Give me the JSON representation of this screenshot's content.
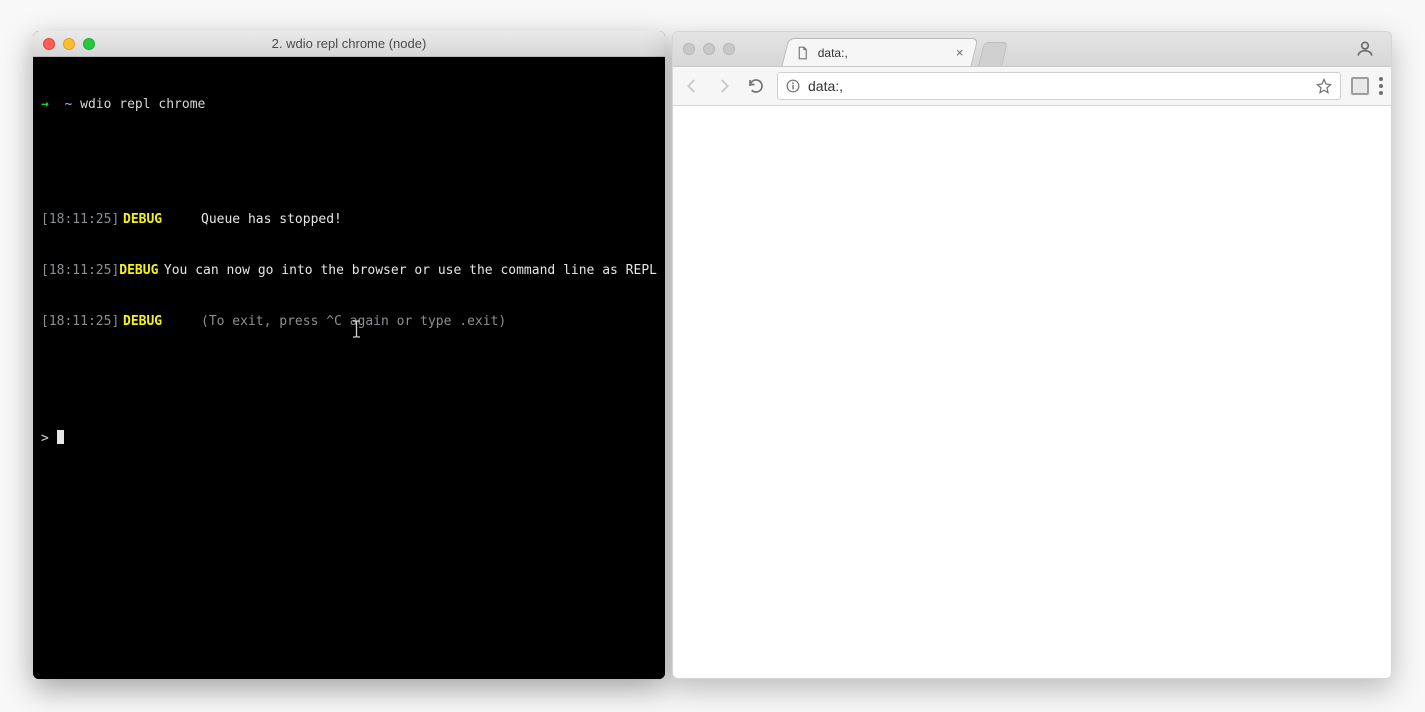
{
  "terminal": {
    "title": "2. wdio repl chrome (node)",
    "prompt": {
      "arrow": "→",
      "path": "~",
      "command": "wdio repl chrome"
    },
    "logs": [
      {
        "timestamp": "[18:11:25]",
        "level": "DEBUG",
        "message": "Queue has stopped!",
        "dim": false
      },
      {
        "timestamp": "[18:11:25]",
        "level": "DEBUG",
        "message": "You can now go into the browser or use the command line as REPL",
        "dim": false
      },
      {
        "timestamp": "[18:11:25]",
        "level": "DEBUG",
        "message": "(To exit, press ^C again or type .exit)",
        "dim": true
      }
    ],
    "repl_caret": ">"
  },
  "browser": {
    "tab": {
      "title": "data:,",
      "close_label": "×"
    },
    "toolbar": {
      "url": "data:,"
    }
  }
}
